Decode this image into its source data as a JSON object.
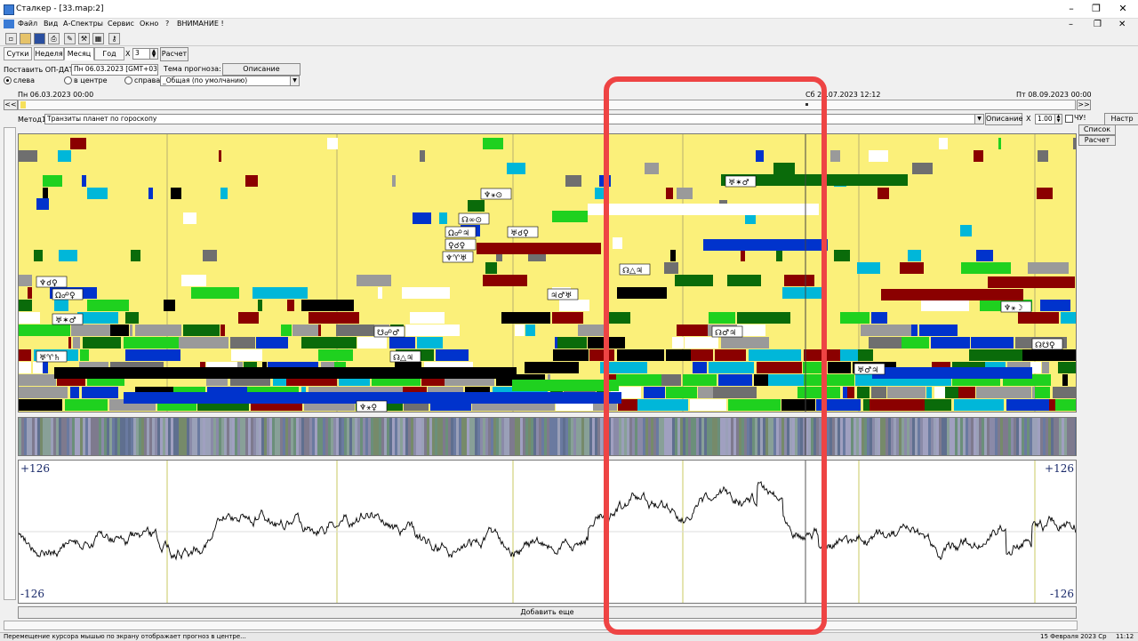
{
  "window": {
    "title": "Сталкер - [33.map:2]",
    "controls": [
      "–",
      "❐",
      "✕"
    ]
  },
  "menu": [
    "Файл",
    "Вид",
    "А-Спектры",
    "Сервис",
    "Окно",
    "?",
    "ВНИМАНИЕ !"
  ],
  "period_tabs": [
    "Сутки",
    "Неделя",
    "Месяц",
    "Год"
  ],
  "active_tab": "Месяц",
  "multiplier": {
    "prefix": "X",
    "value": "3"
  },
  "calc_button": "Расчет",
  "set_on_date": {
    "label": "Поставить ОП-ДАТУ:",
    "value": "Пн 06.03.2023 [GMT+03:00]"
  },
  "forecast_theme": {
    "label": "Тема прогноза:",
    "description_button": "Описание",
    "value": "_Общая (по умолчанию)"
  },
  "positions": [
    {
      "label": "слева",
      "selected": true
    },
    {
      "label": "в центре",
      "selected": false
    },
    {
      "label": "справа",
      "selected": false
    }
  ],
  "timeline": {
    "left_date": "Пн 06.03.2023 00:00",
    "cursor_date": "Сб 29.07.2023 12:12",
    "right_date": "Пт 08.09.2023 00:00",
    "nav_left": "<<",
    "nav_right": ">>"
  },
  "method": {
    "label": "Метод1:",
    "value": "Транзиты планет по гороскопу",
    "description_button": "Описание",
    "close_symbol": "X",
    "scale": "1.00",
    "checkbox_label": "ЧУ!",
    "settings_button": "Настр"
  },
  "side_buttons": {
    "list": "Список",
    "calc": "Расчет"
  },
  "transit_labels": [
    "♅✶♂",
    "♆⚹⊙",
    "☊∞⊙",
    "Ω☍♃",
    "♅☌♀",
    "♀☌♀",
    "♆♈♅",
    "☊△♃",
    "♆☌♀",
    "Ω☍♀",
    "♃♂♅",
    "♆⚹☽",
    "♅✶♂",
    "☋☍♂",
    "☊♂♃",
    "☊☋♀",
    "♅♈♄",
    "☊△♃",
    "♅♂♃",
    "♆⚹♀"
  ],
  "oscillator": {
    "max_label": "+126",
    "min_label": "-126"
  },
  "add_more_button": "Добавить еще",
  "status": {
    "hint": "Перемещение курсора мышью по экрану отображает прогноз в центре...",
    "date": "15 Февраля 2023 Ср",
    "time": "11:12"
  }
}
